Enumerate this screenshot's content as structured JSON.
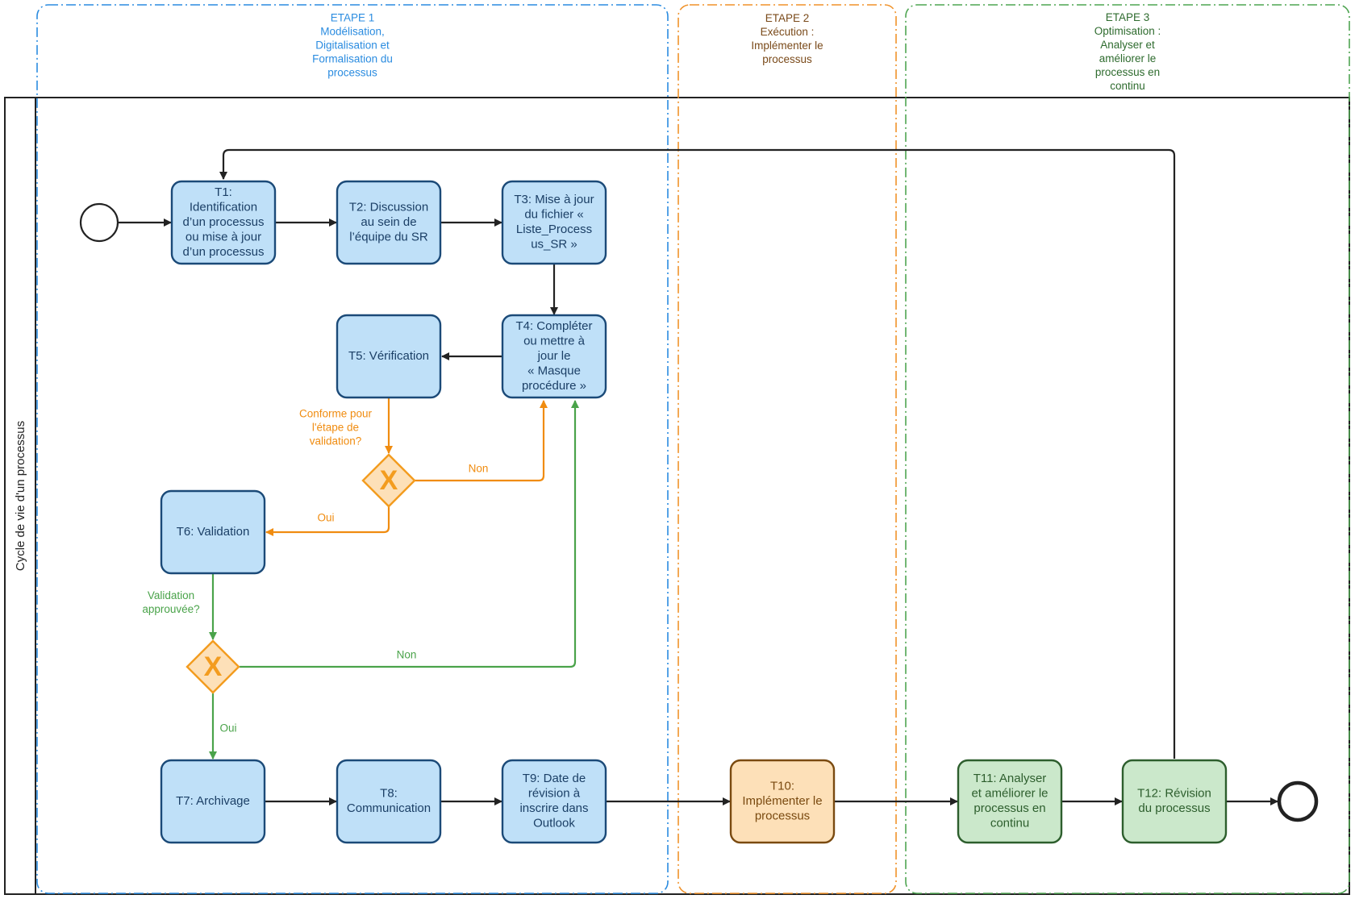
{
  "pool": {
    "label": "Cycle de vie d'un processus"
  },
  "colors": {
    "stage1": "#2b8ce0",
    "stage2": "#f0922a",
    "stage3": "#4fa552",
    "stage1_text": "#2b8ce0",
    "stage2_text": "#7a4a1a",
    "stage3_text": "#2e6b2e",
    "blue_fill": "#bfe0f8",
    "blue_stroke": "#1b4a78",
    "blue_text": "#1b3f66",
    "orange_fill": "#fde0b8",
    "orange_stroke": "#7a4a10",
    "orange_text": "#7a4a10",
    "green_fill": "#cbe8cb",
    "green_stroke": "#2d5e2d",
    "green_text": "#2d5e2d",
    "gateway_fill": "#fde0b8",
    "gateway_stroke": "#f39c1f",
    "flow_black": "#222222",
    "flow_orange": "#f08c10",
    "flow_green": "#4aa34a"
  },
  "stages": [
    {
      "id": "etape1",
      "lines": [
        "ETAPE 1",
        "Modélisation,",
        "Digitalisation et",
        "Formalisation du",
        "processus"
      ]
    },
    {
      "id": "etape2",
      "lines": [
        "ETAPE 2",
        "Exécution :",
        "Implémenter le",
        "processus"
      ]
    },
    {
      "id": "etape3",
      "lines": [
        "ETAPE 3",
        "Optimisation :",
        "Analyser et",
        "améliorer le",
        "processus en",
        "continu"
      ]
    }
  ],
  "tasks": [
    {
      "id": "T1",
      "lines": [
        "T1:",
        "Identification",
        "d’un processus",
        "ou mise à jour",
        "d’un processus"
      ],
      "style": "blue"
    },
    {
      "id": "T2",
      "lines": [
        "T2: Discussion",
        "au sein de",
        "l’équipe du SR"
      ],
      "style": "blue"
    },
    {
      "id": "T3",
      "lines": [
        "T3: Mise à jour",
        "du fichier «",
        "Liste_Process",
        "us_SR »"
      ],
      "style": "blue"
    },
    {
      "id": "T4",
      "lines": [
        "T4: Compléter",
        "ou mettre à",
        "jour le",
        "« Masque",
        "procédure »"
      ],
      "style": "blue"
    },
    {
      "id": "T5",
      "lines": [
        "T5: Vérification"
      ],
      "style": "blue"
    },
    {
      "id": "T6",
      "lines": [
        "T6: Validation"
      ],
      "style": "blue"
    },
    {
      "id": "T7",
      "lines": [
        "T7: Archivage"
      ],
      "style": "blue"
    },
    {
      "id": "T8",
      "lines": [
        "T8:",
        "Communication"
      ],
      "style": "blue"
    },
    {
      "id": "T9",
      "lines": [
        "T9: Date de",
        "révision à",
        "inscrire dans",
        "Outlook"
      ],
      "style": "blue"
    },
    {
      "id": "T10",
      "lines": [
        "T10:",
        "Implémenter le",
        "processus"
      ],
      "style": "orange"
    },
    {
      "id": "T11",
      "lines": [
        "T11: Analyser",
        "et améliorer le",
        "processus en",
        "continu"
      ],
      "style": "green"
    },
    {
      "id": "T12",
      "lines": [
        "T12: Révision",
        "du processus"
      ],
      "style": "green"
    }
  ],
  "gateways": [
    {
      "id": "G1",
      "symbol": "X",
      "question": [
        "Conforme pour",
        "l'étape de",
        "validation?"
      ],
      "yes": "Oui",
      "no": "Non"
    },
    {
      "id": "G2",
      "symbol": "X",
      "question": [
        "Validation",
        "approuvée?"
      ],
      "yes": "Oui",
      "no": "Non"
    }
  ],
  "events": [
    {
      "id": "start",
      "type": "start-event"
    },
    {
      "id": "end",
      "type": "end-event"
    }
  ]
}
